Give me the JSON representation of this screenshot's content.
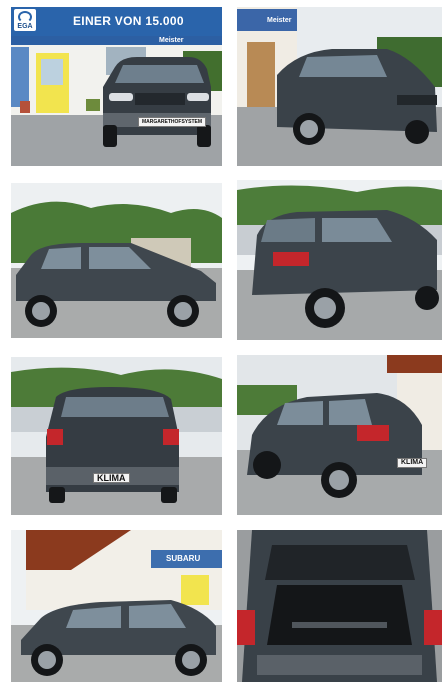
{
  "banner": {
    "logo_text": "EGA",
    "headline": "EINER VON 15.000"
  },
  "signs": {
    "dealer_sign_1": "Meister",
    "dealer_sign_2": "Meister",
    "subaru_sign": "SUBARU"
  },
  "plates": {
    "front_plate": "MARGARETHOFSYSTEM",
    "rear_plate": "KLIMA",
    "rear_plate_2": "KLIMA"
  },
  "colors": {
    "banner_blue": "#2a64ab",
    "car_grey": "#3e464e",
    "sky": "#e9eef3",
    "asphalt": "#a4a7a8",
    "foliage": "#3c6b33"
  },
  "icons": [
    "ega-logo-icon"
  ]
}
